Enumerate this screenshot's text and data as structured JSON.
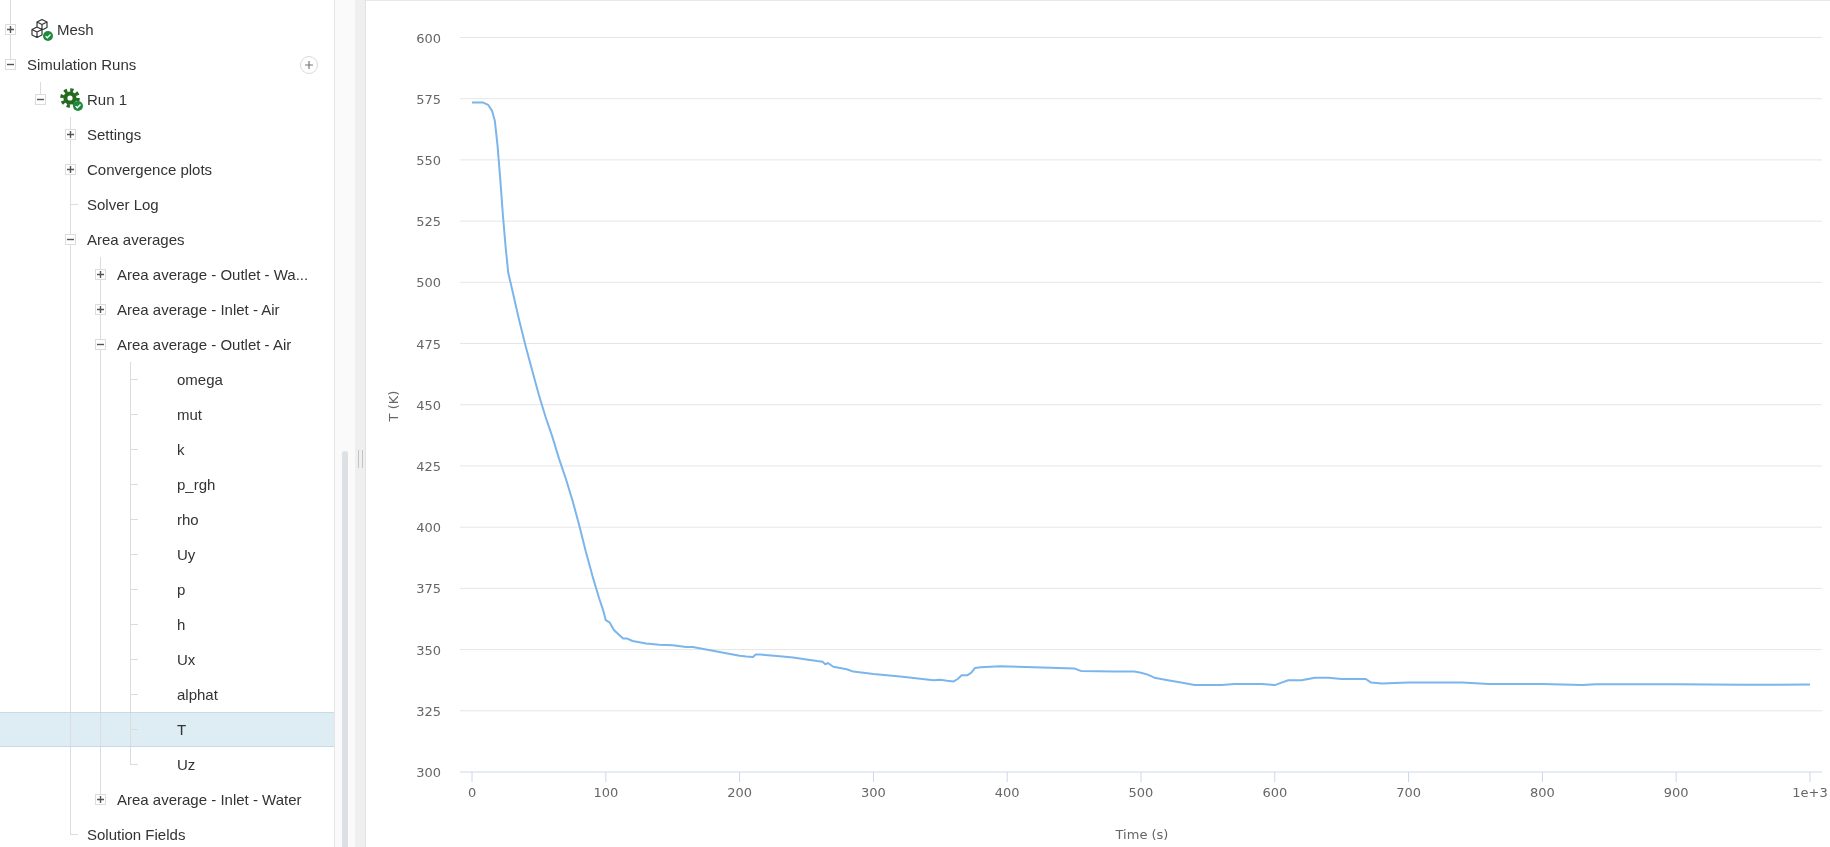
{
  "tree": {
    "items": [
      {
        "label": "Mesh",
        "kind": "mesh",
        "expanded": false,
        "done": true,
        "selected": false
      },
      {
        "label": "Simulation Runs",
        "kind": "section",
        "expanded": true,
        "selected": false,
        "children": [
          {
            "label": "Run 1",
            "kind": "run",
            "expanded": true,
            "done": true,
            "selected": false,
            "children": [
              {
                "label": "Settings",
                "kind": "folder",
                "expanded": false,
                "selected": false
              },
              {
                "label": "Convergence plots",
                "kind": "folder",
                "expanded": false,
                "selected": false
              },
              {
                "label": "Solver Log",
                "kind": "entry",
                "selected": false
              },
              {
                "label": "Area averages",
                "kind": "folder",
                "expanded": true,
                "selected": false,
                "children": [
                  {
                    "label": "Area average - Outlet - Wa...",
                    "kind": "folder",
                    "expanded": false,
                    "selected": false
                  },
                  {
                    "label": "Area average - Inlet - Air",
                    "kind": "folder",
                    "expanded": false,
                    "selected": false
                  },
                  {
                    "label": "Area average - Outlet - Air",
                    "kind": "folder",
                    "expanded": true,
                    "selected": false,
                    "children": [
                      {
                        "label": "omega",
                        "kind": "result",
                        "selected": false
                      },
                      {
                        "label": "mut",
                        "kind": "result",
                        "selected": false
                      },
                      {
                        "label": "k",
                        "kind": "result",
                        "selected": false
                      },
                      {
                        "label": "p_rgh",
                        "kind": "result",
                        "selected": false
                      },
                      {
                        "label": "rho",
                        "kind": "result",
                        "selected": false
                      },
                      {
                        "label": "Uy",
                        "kind": "result",
                        "selected": false
                      },
                      {
                        "label": "p",
                        "kind": "result",
                        "selected": false
                      },
                      {
                        "label": "h",
                        "kind": "result",
                        "selected": false
                      },
                      {
                        "label": "Ux",
                        "kind": "result",
                        "selected": false
                      },
                      {
                        "label": "alphat",
                        "kind": "result",
                        "selected": false
                      },
                      {
                        "label": "T",
                        "kind": "result",
                        "selected": true
                      },
                      {
                        "label": "Uz",
                        "kind": "result",
                        "selected": false
                      }
                    ]
                  },
                  {
                    "label": "Area average - Inlet - Water",
                    "kind": "folder",
                    "expanded": false,
                    "selected": false
                  }
                ]
              },
              {
                "label": "Solution Fields",
                "kind": "entry",
                "selected": false
              }
            ]
          }
        ]
      }
    ]
  },
  "chart": {
    "chart_data": {
      "type": "line",
      "xlabel": "Time (s)",
      "ylabel": "T (K)",
      "grid": true,
      "x": [
        0,
        8,
        12,
        15,
        17,
        19,
        21,
        23,
        25,
        27,
        30,
        35,
        40,
        45,
        50,
        55,
        60,
        65,
        70,
        75,
        80,
        85,
        90,
        95,
        98,
        100,
        103,
        106,
        110,
        113,
        116,
        120,
        130,
        140,
        150,
        160,
        165,
        180,
        190,
        200,
        205,
        210,
        212,
        215,
        230,
        240,
        250,
        258,
        262,
        264,
        266,
        270,
        275,
        280,
        285,
        300,
        320,
        340,
        345,
        350,
        355,
        360,
        363,
        366,
        370,
        373,
        376,
        380,
        395,
        420,
        450,
        455,
        480,
        495,
        500,
        505,
        510,
        520,
        530,
        540,
        550,
        560,
        570,
        580,
        590,
        600,
        605,
        610,
        620,
        630,
        640,
        650,
        660,
        668,
        672,
        680,
        690,
        700,
        740,
        760,
        800,
        830,
        840,
        900,
        950,
        1000
      ],
      "series": [
        {
          "color": "#7cb5ec",
          "values": [
            573.5,
            573.5,
            572.5,
            570,
            566,
            556,
            543,
            528,
            515,
            504,
            497,
            485,
            474,
            464,
            454,
            445,
            437,
            428,
            420,
            411,
            401,
            390,
            380,
            371,
            366,
            362,
            361,
            358,
            356,
            354.5,
            354.5,
            353.5,
            352.5,
            352,
            351.8,
            351,
            351,
            349.5,
            348.5,
            347.5,
            347.2,
            347,
            348,
            348,
            347.3,
            346.8,
            346,
            345.3,
            345,
            344,
            344.5,
            343,
            342.5,
            342,
            341,
            340,
            339,
            337.8,
            337.5,
            337.7,
            337.3,
            337,
            338,
            339.5,
            339.5,
            340.5,
            342.5,
            342.8,
            343.2,
            342.8,
            342.3,
            341.3,
            341,
            341,
            340.5,
            339.8,
            338.5,
            337.5,
            336.5,
            335.5,
            335.5,
            335.5,
            336,
            336,
            336,
            335.5,
            336.5,
            337.5,
            337.5,
            338.5,
            338.5,
            338,
            338,
            338,
            336.5,
            336.2,
            336.3,
            336.5,
            336.5,
            336,
            336,
            335.5,
            335.8,
            335.8,
            335.6,
            335.7
          ]
        }
      ],
      "xlim": [
        -9,
        1009
      ],
      "ylim": [
        300,
        600
      ],
      "xticks": [
        0,
        100,
        200,
        300,
        400,
        500,
        600,
        700,
        800,
        900,
        {
          "value": 1000,
          "label": "1e+3"
        }
      ],
      "yticks": [
        300,
        325,
        350,
        375,
        400,
        425,
        450,
        475,
        500,
        525,
        550,
        575,
        600
      ]
    }
  }
}
